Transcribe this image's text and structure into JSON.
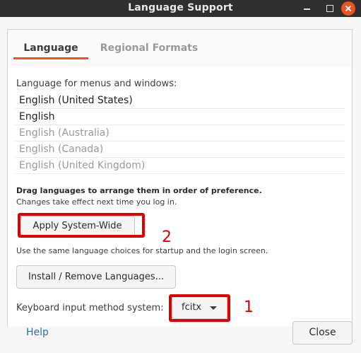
{
  "window": {
    "title": "Language Support"
  },
  "tabs": [
    {
      "label": "Language",
      "active": true
    },
    {
      "label": "Regional Formats",
      "active": false
    }
  ],
  "language": {
    "list_label": "Language for menus and windows:",
    "items": [
      {
        "label": "English (United States)",
        "enabled": true
      },
      {
        "label": "English",
        "enabled": true
      },
      {
        "label": "English (Australia)",
        "enabled": false
      },
      {
        "label": "English (Canada)",
        "enabled": false
      },
      {
        "label": "English (United Kingdom)",
        "enabled": false
      }
    ],
    "drag_hint": "Drag languages to arrange them in order of preference.",
    "drag_sub": "Changes take effect next time you log in.",
    "apply_button": "Apply System-Wide",
    "same_choices_note": "Use the same language choices for startup and the login screen.",
    "install_button": "Install / Remove Languages...",
    "keyboard_label": "Keyboard input method system:",
    "keyboard_value": "fcitx"
  },
  "annotations": {
    "mark_1": "1",
    "mark_2": "2",
    "highlight_color": "#e00000"
  },
  "footer": {
    "help": "Help",
    "close": "Close"
  },
  "colors": {
    "accent": "#e95420",
    "titlebar": "#2f2f2f",
    "link": "#2a6db2"
  }
}
